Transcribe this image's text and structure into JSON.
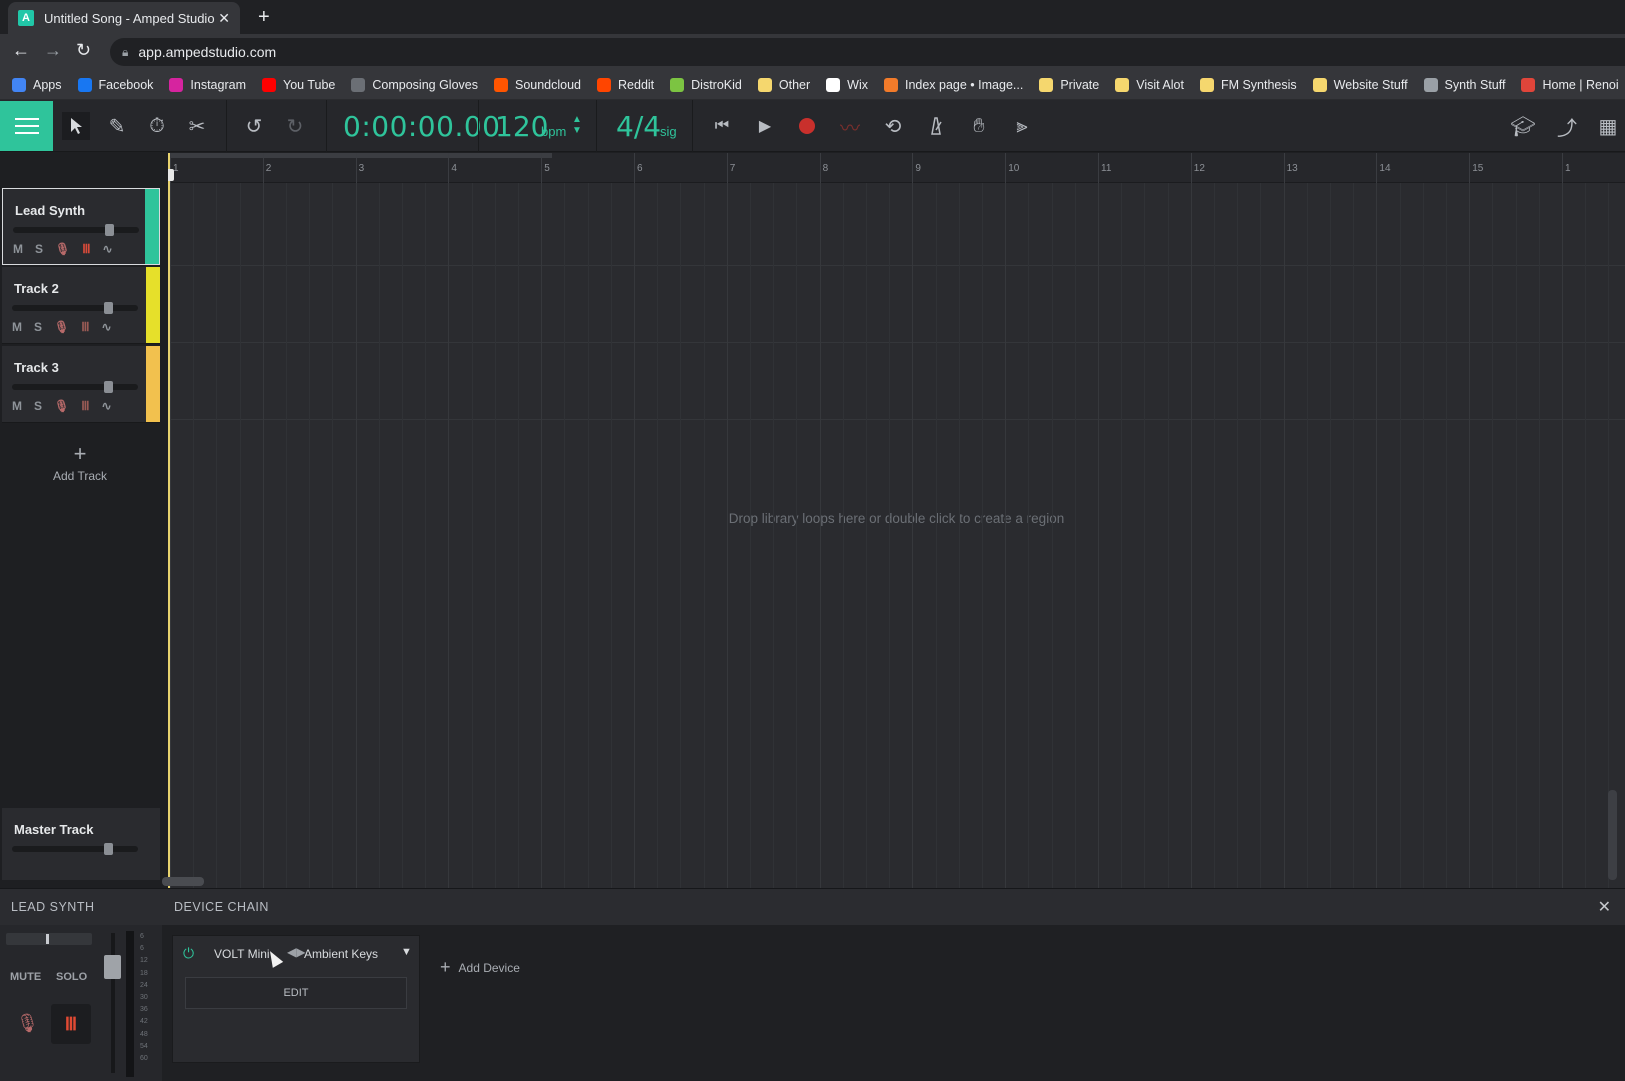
{
  "browser": {
    "tab_title": "Untitled Song - Amped Studio",
    "tab_favicon": "A",
    "url": "app.ampedstudio.com",
    "bookmarks": [
      {
        "label": "Apps",
        "icon": "apps-grid-icon",
        "color": "#4285f4"
      },
      {
        "label": "Facebook",
        "icon": "facebook-icon",
        "color": "#1877f2"
      },
      {
        "label": "Instagram",
        "icon": "instagram-icon",
        "color": "#d6249f"
      },
      {
        "label": "You Tube",
        "icon": "youtube-icon",
        "color": "#ff0000"
      },
      {
        "label": "Composing Gloves",
        "icon": "glove-icon",
        "color": "#6b6f75"
      },
      {
        "label": "Soundcloud",
        "icon": "soundcloud-icon",
        "color": "#ff5500"
      },
      {
        "label": "Reddit",
        "icon": "reddit-icon",
        "color": "#ff4500"
      },
      {
        "label": "DistroKid",
        "icon": "distrokid-icon",
        "color": "#7cc442"
      },
      {
        "label": "Other",
        "icon": "folder-icon",
        "color": "#f5d76e"
      },
      {
        "label": "Wix",
        "icon": "wix-icon",
        "color": "#ffffff"
      },
      {
        "label": "Index page • Image...",
        "icon": "flame-icon",
        "color": "#f27b2a"
      },
      {
        "label": "Private",
        "icon": "folder-icon",
        "color": "#f5d76e"
      },
      {
        "label": "Visit Alot",
        "icon": "folder-icon",
        "color": "#f5d76e"
      },
      {
        "label": "FM Synthesis",
        "icon": "folder-icon",
        "color": "#f5d76e"
      },
      {
        "label": "Website Stuff",
        "icon": "folder-icon",
        "color": "#f5d76e"
      },
      {
        "label": "Synth Stuff",
        "icon": "globe-icon",
        "color": "#9aa0a6"
      },
      {
        "label": "Home | Renoi",
        "icon": "renoise-icon",
        "color": "#e0453a"
      }
    ]
  },
  "toolbar": {
    "time": "0:00:00.00",
    "bpm": "120",
    "bpm_unit": "bpm",
    "sig": "4/4",
    "sig_unit": "sig",
    "accent": "#2fc49b"
  },
  "tracks": [
    {
      "name": "Lead Synth",
      "color": "#2fc49b",
      "volume": 0.75,
      "selected": true
    },
    {
      "name": "Track 2",
      "color": "#e6e02a",
      "volume": 0.75,
      "selected": false
    },
    {
      "name": "Track 3",
      "color": "#f2c14e",
      "volume": 0.75,
      "selected": false
    }
  ],
  "track_buttons": {
    "mute": "M",
    "solo": "S"
  },
  "add_track_label": "Add Track",
  "master": {
    "name": "Master Track",
    "volume": 0.75
  },
  "ruler": {
    "bars": [
      "1",
      "2",
      "3",
      "4",
      "5",
      "6",
      "7",
      "8",
      "9",
      "10",
      "11",
      "12",
      "13",
      "14",
      "15",
      "1"
    ]
  },
  "timeline_hint": "Drop library loops here or double click to create a region",
  "lead_panel": {
    "title": "LEAD SYNTH",
    "mute": "MUTE",
    "solo": "SOLO",
    "meter_scale": [
      "6",
      "6",
      "12",
      "18",
      "24",
      "30",
      "36",
      "42",
      "48",
      "54",
      "60"
    ]
  },
  "device_chain": {
    "title": "DEVICE CHAIN",
    "device_name": "VOLT Mini",
    "preset": "Ambient Keys",
    "edit_label": "EDIT",
    "add_device_label": "Add Device"
  }
}
